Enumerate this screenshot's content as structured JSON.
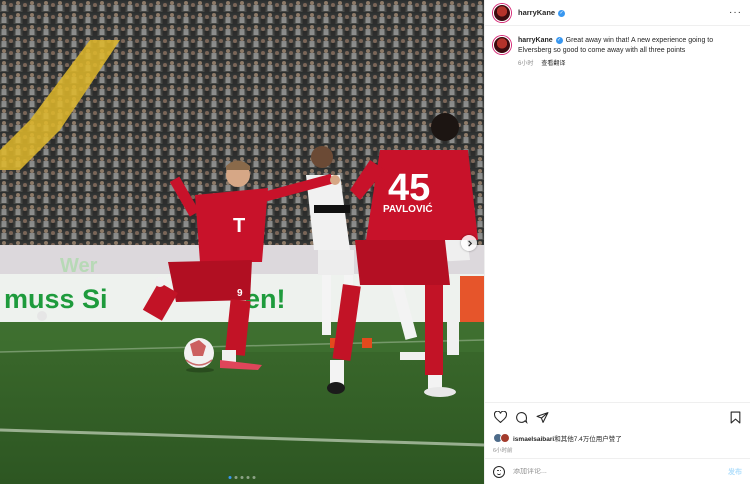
{
  "post": {
    "username": "harryKane",
    "verified_icon": "verified-badge-icon",
    "more_icon": "more-options-icon"
  },
  "caption": {
    "username": "harryKane",
    "text": "Great away win that! A new experience going to Elversberg so good to come away with all three points",
    "time": "6小时",
    "translate": "查看翻译"
  },
  "media": {
    "stadium_banner_top": "Wer",
    "stadium_banner_text": "muss Sie   en!",
    "jersey_number_shooter": "9",
    "jersey_number_back": "45",
    "jersey_name_back": "PAVLOVIĆ",
    "carousel_dots": 5,
    "active_dot": 1,
    "next_icon": "chevron-right-icon"
  },
  "actions": {
    "like_icon": "heart-icon",
    "comment_icon": "comment-icon",
    "share_icon": "paper-plane-icon",
    "save_icon": "bookmark-icon"
  },
  "likes": {
    "user": "ismaelsaibari",
    "rest": "和其他7.4万位用户赞了"
  },
  "timestamp": "6小时前",
  "comment_box": {
    "placeholder": "添加评论...",
    "post_label": "发布",
    "emoji_icon": "emoji-icon"
  },
  "colors": {
    "accent": "#3897f0",
    "post_disabled": "#b2dffc",
    "meta_gray": "#8e8e8e",
    "bayern_red": "#d0101f"
  }
}
